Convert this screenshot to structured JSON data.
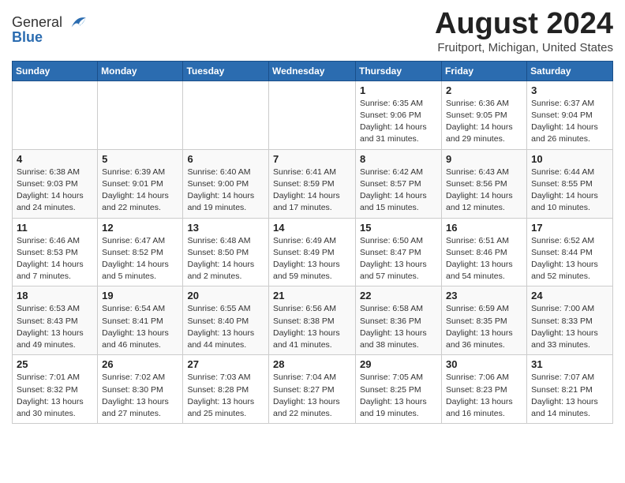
{
  "header": {
    "logo_general": "General",
    "logo_blue": "Blue",
    "month_title": "August 2024",
    "location": "Fruitport, Michigan, United States"
  },
  "days_of_week": [
    "Sunday",
    "Monday",
    "Tuesday",
    "Wednesday",
    "Thursday",
    "Friday",
    "Saturday"
  ],
  "weeks": [
    [
      {
        "day": "",
        "info": ""
      },
      {
        "day": "",
        "info": ""
      },
      {
        "day": "",
        "info": ""
      },
      {
        "day": "",
        "info": ""
      },
      {
        "day": "1",
        "info": "Sunrise: 6:35 AM\nSunset: 9:06 PM\nDaylight: 14 hours\nand 31 minutes."
      },
      {
        "day": "2",
        "info": "Sunrise: 6:36 AM\nSunset: 9:05 PM\nDaylight: 14 hours\nand 29 minutes."
      },
      {
        "day": "3",
        "info": "Sunrise: 6:37 AM\nSunset: 9:04 PM\nDaylight: 14 hours\nand 26 minutes."
      }
    ],
    [
      {
        "day": "4",
        "info": "Sunrise: 6:38 AM\nSunset: 9:03 PM\nDaylight: 14 hours\nand 24 minutes."
      },
      {
        "day": "5",
        "info": "Sunrise: 6:39 AM\nSunset: 9:01 PM\nDaylight: 14 hours\nand 22 minutes."
      },
      {
        "day": "6",
        "info": "Sunrise: 6:40 AM\nSunset: 9:00 PM\nDaylight: 14 hours\nand 19 minutes."
      },
      {
        "day": "7",
        "info": "Sunrise: 6:41 AM\nSunset: 8:59 PM\nDaylight: 14 hours\nand 17 minutes."
      },
      {
        "day": "8",
        "info": "Sunrise: 6:42 AM\nSunset: 8:57 PM\nDaylight: 14 hours\nand 15 minutes."
      },
      {
        "day": "9",
        "info": "Sunrise: 6:43 AM\nSunset: 8:56 PM\nDaylight: 14 hours\nand 12 minutes."
      },
      {
        "day": "10",
        "info": "Sunrise: 6:44 AM\nSunset: 8:55 PM\nDaylight: 14 hours\nand 10 minutes."
      }
    ],
    [
      {
        "day": "11",
        "info": "Sunrise: 6:46 AM\nSunset: 8:53 PM\nDaylight: 14 hours\nand 7 minutes."
      },
      {
        "day": "12",
        "info": "Sunrise: 6:47 AM\nSunset: 8:52 PM\nDaylight: 14 hours\nand 5 minutes."
      },
      {
        "day": "13",
        "info": "Sunrise: 6:48 AM\nSunset: 8:50 PM\nDaylight: 14 hours\nand 2 minutes."
      },
      {
        "day": "14",
        "info": "Sunrise: 6:49 AM\nSunset: 8:49 PM\nDaylight: 13 hours\nand 59 minutes."
      },
      {
        "day": "15",
        "info": "Sunrise: 6:50 AM\nSunset: 8:47 PM\nDaylight: 13 hours\nand 57 minutes."
      },
      {
        "day": "16",
        "info": "Sunrise: 6:51 AM\nSunset: 8:46 PM\nDaylight: 13 hours\nand 54 minutes."
      },
      {
        "day": "17",
        "info": "Sunrise: 6:52 AM\nSunset: 8:44 PM\nDaylight: 13 hours\nand 52 minutes."
      }
    ],
    [
      {
        "day": "18",
        "info": "Sunrise: 6:53 AM\nSunset: 8:43 PM\nDaylight: 13 hours\nand 49 minutes."
      },
      {
        "day": "19",
        "info": "Sunrise: 6:54 AM\nSunset: 8:41 PM\nDaylight: 13 hours\nand 46 minutes."
      },
      {
        "day": "20",
        "info": "Sunrise: 6:55 AM\nSunset: 8:40 PM\nDaylight: 13 hours\nand 44 minutes."
      },
      {
        "day": "21",
        "info": "Sunrise: 6:56 AM\nSunset: 8:38 PM\nDaylight: 13 hours\nand 41 minutes."
      },
      {
        "day": "22",
        "info": "Sunrise: 6:58 AM\nSunset: 8:36 PM\nDaylight: 13 hours\nand 38 minutes."
      },
      {
        "day": "23",
        "info": "Sunrise: 6:59 AM\nSunset: 8:35 PM\nDaylight: 13 hours\nand 36 minutes."
      },
      {
        "day": "24",
        "info": "Sunrise: 7:00 AM\nSunset: 8:33 PM\nDaylight: 13 hours\nand 33 minutes."
      }
    ],
    [
      {
        "day": "25",
        "info": "Sunrise: 7:01 AM\nSunset: 8:32 PM\nDaylight: 13 hours\nand 30 minutes."
      },
      {
        "day": "26",
        "info": "Sunrise: 7:02 AM\nSunset: 8:30 PM\nDaylight: 13 hours\nand 27 minutes."
      },
      {
        "day": "27",
        "info": "Sunrise: 7:03 AM\nSunset: 8:28 PM\nDaylight: 13 hours\nand 25 minutes."
      },
      {
        "day": "28",
        "info": "Sunrise: 7:04 AM\nSunset: 8:27 PM\nDaylight: 13 hours\nand 22 minutes."
      },
      {
        "day": "29",
        "info": "Sunrise: 7:05 AM\nSunset: 8:25 PM\nDaylight: 13 hours\nand 19 minutes."
      },
      {
        "day": "30",
        "info": "Sunrise: 7:06 AM\nSunset: 8:23 PM\nDaylight: 13 hours\nand 16 minutes."
      },
      {
        "day": "31",
        "info": "Sunrise: 7:07 AM\nSunset: 8:21 PM\nDaylight: 13 hours\nand 14 minutes."
      }
    ]
  ]
}
